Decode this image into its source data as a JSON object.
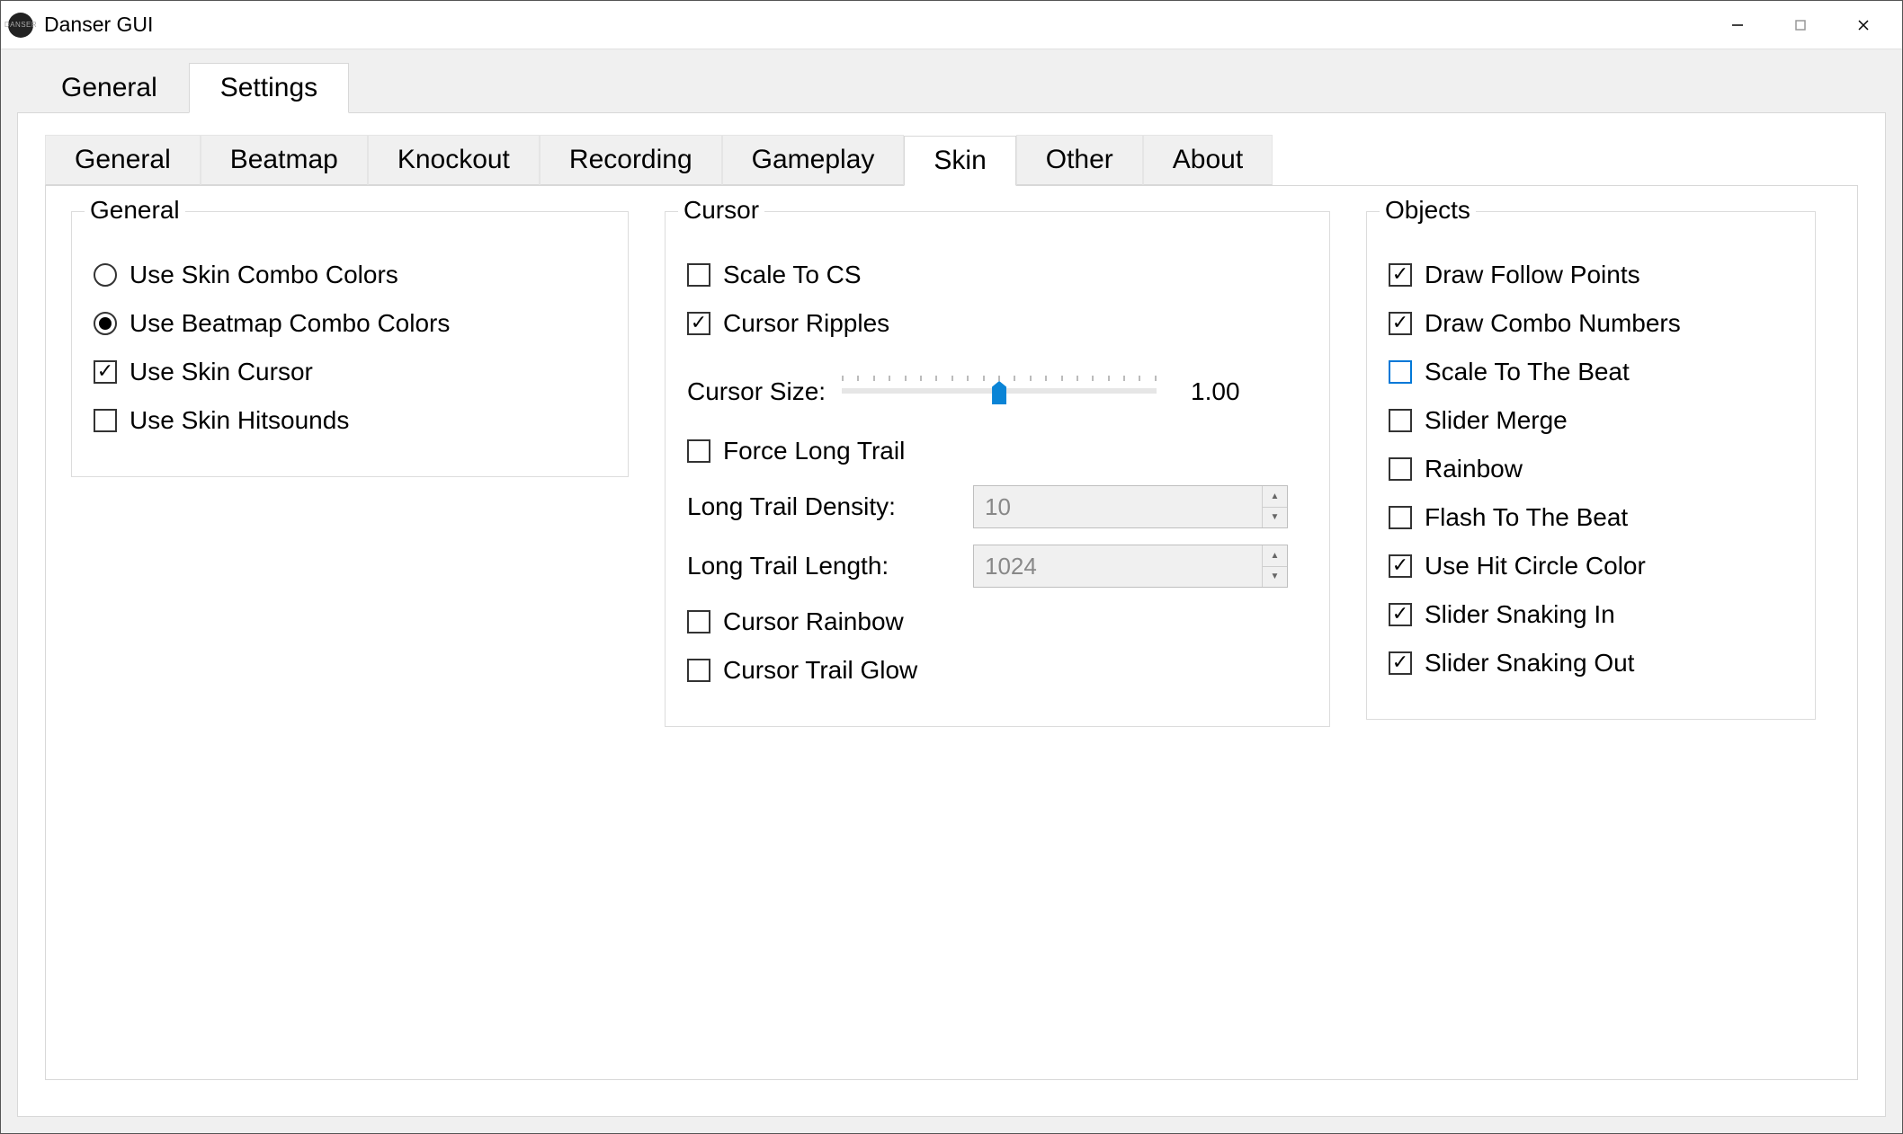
{
  "window": {
    "title": "Danser GUI"
  },
  "top_tabs": [
    "General",
    "Settings"
  ],
  "top_tab_active": 1,
  "sub_tabs": [
    "General",
    "Beatmap",
    "Knockout",
    "Recording",
    "Gameplay",
    "Skin",
    "Other",
    "About"
  ],
  "sub_tab_active": 5,
  "general_group": {
    "title": "General",
    "combo_mode": "beatmap",
    "radio_skin_label": "Use Skin Combo Colors",
    "radio_beatmap_label": "Use Beatmap Combo Colors",
    "use_skin_cursor": {
      "label": "Use Skin Cursor",
      "checked": true
    },
    "use_skin_hitsounds": {
      "label": "Use Skin Hitsounds",
      "checked": false
    }
  },
  "cursor_group": {
    "title": "Cursor",
    "scale_to_cs": {
      "label": "Scale To CS",
      "checked": false
    },
    "cursor_ripples": {
      "label": "Cursor Ripples",
      "checked": true
    },
    "cursor_size": {
      "label": "Cursor Size:",
      "value": "1.00",
      "min": 0,
      "max": 2,
      "pos": 0.5
    },
    "force_long_trail": {
      "label": "Force Long Trail",
      "checked": false
    },
    "long_trail_density": {
      "label": "Long Trail Density:",
      "value": "10"
    },
    "long_trail_length": {
      "label": "Long Trail Length:",
      "value": "1024"
    },
    "cursor_rainbow": {
      "label": "Cursor Rainbow",
      "checked": false
    },
    "cursor_trail_glow": {
      "label": "Cursor Trail Glow",
      "checked": false
    }
  },
  "objects_group": {
    "title": "Objects",
    "draw_follow_points": {
      "label": "Draw Follow Points",
      "checked": true
    },
    "draw_combo_numbers": {
      "label": "Draw Combo Numbers",
      "checked": true
    },
    "scale_to_the_beat": {
      "label": "Scale To The Beat",
      "checked": false,
      "highlight": true
    },
    "slider_merge": {
      "label": "Slider Merge",
      "checked": false
    },
    "rainbow": {
      "label": "Rainbow",
      "checked": false
    },
    "flash_to_the_beat": {
      "label": "Flash To The Beat",
      "checked": false
    },
    "use_hit_circle_color": {
      "label": "Use Hit Circle Color",
      "checked": true
    },
    "slider_snaking_in": {
      "label": "Slider Snaking In",
      "checked": true
    },
    "slider_snaking_out": {
      "label": "Slider Snaking Out",
      "checked": true
    }
  }
}
